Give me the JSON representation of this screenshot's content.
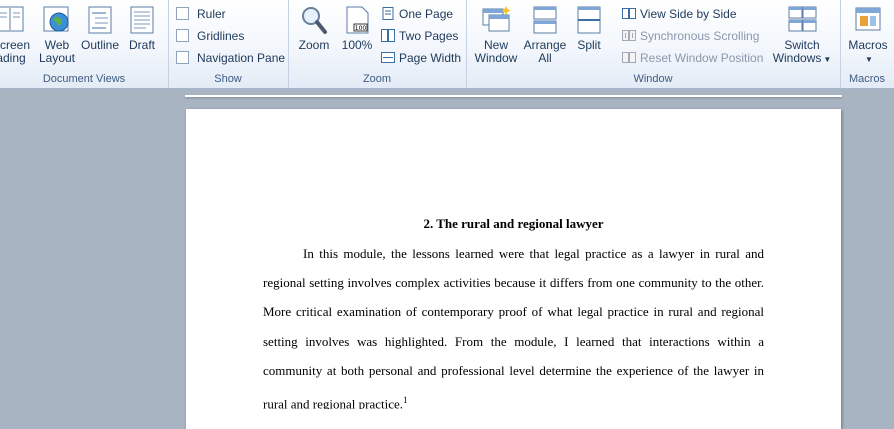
{
  "ribbon": {
    "document_views": {
      "label": "Document Views",
      "full_screen_reading": [
        "Screen",
        "ading"
      ],
      "web_layout": [
        "Web",
        "Layout"
      ],
      "outline": "Outline",
      "draft": "Draft"
    },
    "show": {
      "label": "Show",
      "ruler": "Ruler",
      "gridlines": "Gridlines",
      "navigation_pane": "Navigation Pane"
    },
    "zoom": {
      "label": "Zoom",
      "zoom_button": "Zoom",
      "percent_button": "100%",
      "one_page": "One Page",
      "two_pages": "Two Pages",
      "page_width": "Page Width"
    },
    "window": {
      "label": "Window",
      "new_window": [
        "New",
        "Window"
      ],
      "arrange_all": [
        "Arrange",
        "All"
      ],
      "split": "Split",
      "view_side_by_side": "View Side by Side",
      "synchronous_scrolling": "Synchronous Scrolling",
      "reset_window_position": "Reset Window Position",
      "switch_windows": [
        "Switch",
        "Windows"
      ]
    },
    "macros": {
      "label": "Macros",
      "macros_button": "Macros"
    }
  },
  "document": {
    "heading": "2. The rural and regional lawyer",
    "lines": [
      "In this module, the lessons learned were that legal practice as a lawyer in rural and",
      "regional setting involves complex activities because it differs from one community to the other.",
      "More critical examination of contemporary proof of what legal practice in rural and regional",
      "setting involves was highlighted. From the module, I learned that interactions within a",
      "community at both personal and professional level determine the experience of the lawyer in",
      "rural and regional practice."
    ],
    "footnote_marker": "1"
  },
  "colors": {
    "ribbon_text": "#1e395b",
    "group_label": "#3e5b80",
    "workspace": "#a9b4c2",
    "page": "#ffffff"
  }
}
